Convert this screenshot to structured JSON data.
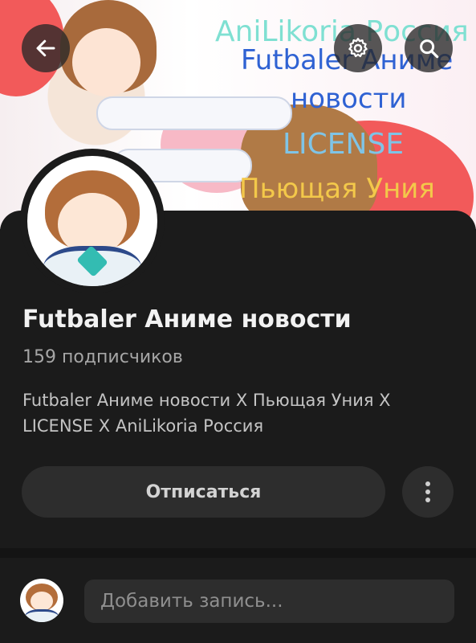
{
  "cover": {
    "lines": [
      {
        "text": "AniLikoria Россия",
        "color": "#7fe0d2"
      },
      {
        "text": "Futbaler Аниме",
        "color": "#2f62d3"
      },
      {
        "text": "новости",
        "color": "#2f62d3"
      },
      {
        "text": "LICENSE",
        "color": "#7fc4e6"
      },
      {
        "text": "Пьющая Уния",
        "color": "#f3c84a"
      }
    ]
  },
  "header": {
    "back_icon": "arrow-left-icon",
    "settings_icon": "gear-icon",
    "search_icon": "search-icon"
  },
  "community": {
    "name": "Futbaler Аниме новости",
    "subscribers": "159 подписчиков",
    "description": "Futbaler Аниме новости X Пьющая Уния X LICENSE X AniLikoria Россия"
  },
  "actions": {
    "unsubscribe_label": "Отписаться",
    "more_icon": "more-vertical-icon"
  },
  "post": {
    "placeholder": "Добавить запись..."
  }
}
